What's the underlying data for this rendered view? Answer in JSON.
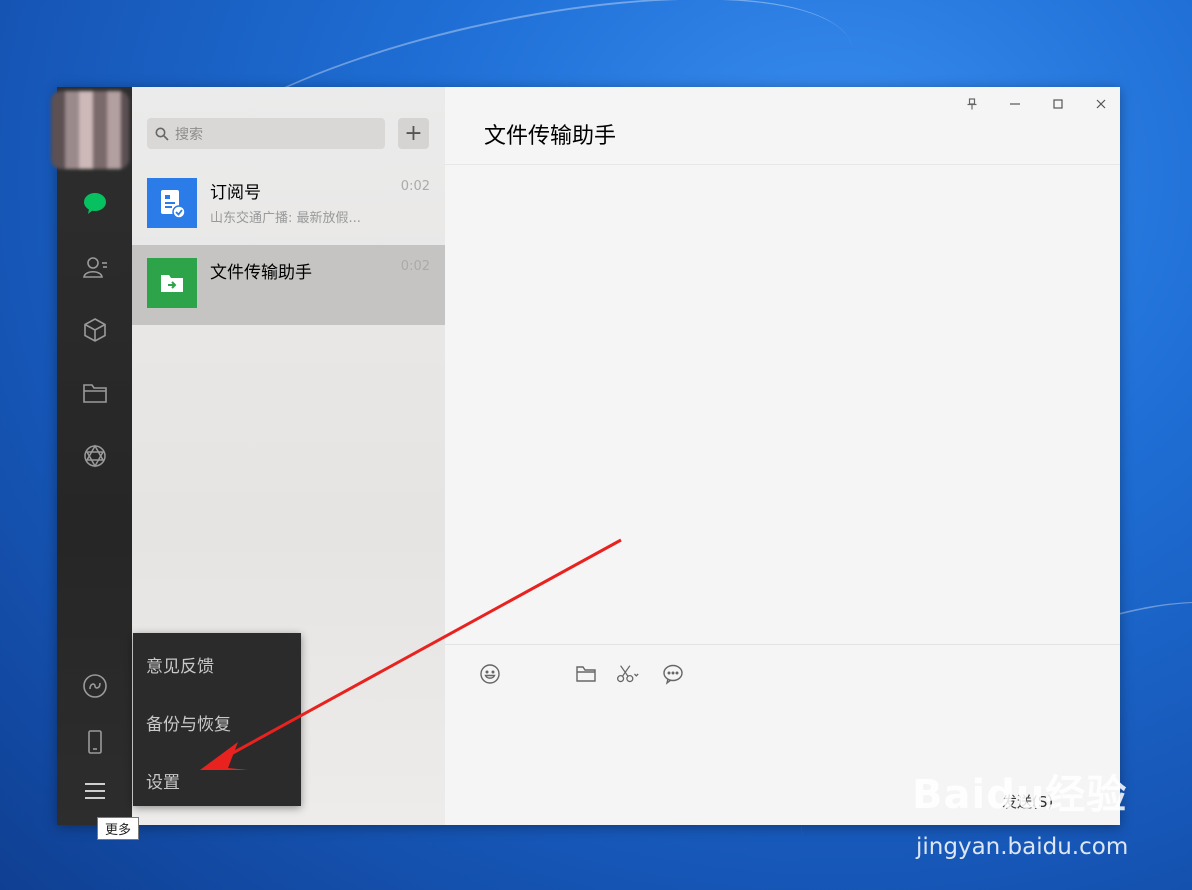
{
  "sidebar": {
    "icons": [
      "chat-icon",
      "contacts-icon",
      "favorites-icon",
      "files-icon",
      "moments-icon",
      "mini-programs-icon",
      "phone-icon",
      "menu-icon"
    ],
    "accent": "#07c160"
  },
  "search": {
    "placeholder": "搜索",
    "add_label": "+"
  },
  "conversations": [
    {
      "name": "订阅号",
      "preview": "山东交通广播: 最新放假...",
      "time": "0:02",
      "icon": "subscription-icon",
      "color": "#2b7ce9"
    },
    {
      "name": "文件传输助手",
      "preview": "",
      "time": "0:02",
      "icon": "file-transfer-icon",
      "color": "#2ea44a"
    }
  ],
  "chat": {
    "title": "文件传输助手",
    "window_controls": [
      "pin-icon",
      "minimize-icon",
      "maximize-icon",
      "close-icon"
    ],
    "toolbar": [
      "emoji-icon",
      "folder-icon",
      "screenshot-icon",
      "chat-history-icon"
    ],
    "send_label": "发送(S)"
  },
  "more_menu": {
    "items": [
      "意见反馈",
      "备份与恢复",
      "设置"
    ],
    "tooltip": "更多"
  },
  "watermark": {
    "brand": "Baidu经验",
    "url": "jingyan.baidu.com"
  }
}
